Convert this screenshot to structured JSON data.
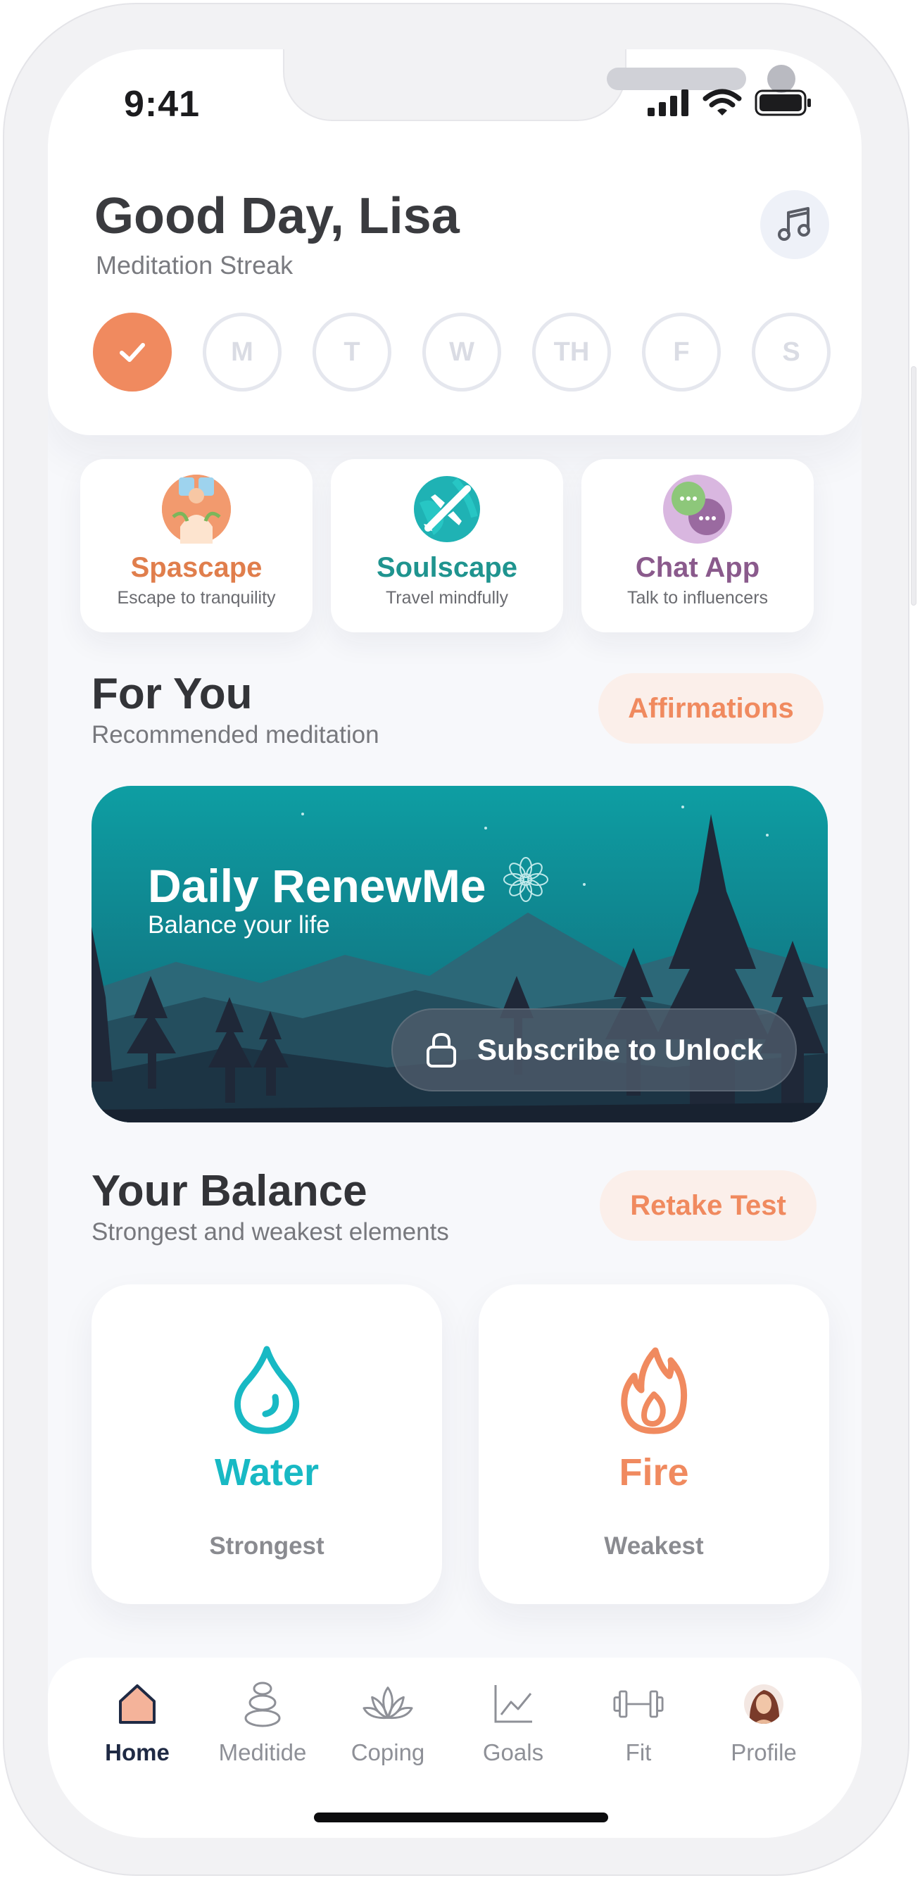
{
  "status_bar": {
    "time": "9:41"
  },
  "header": {
    "greeting": "Good Day, Lisa",
    "streak_label": "Meditation Streak",
    "days": [
      "M",
      "T",
      "W",
      "TH",
      "F",
      "S"
    ]
  },
  "apps": [
    {
      "title": "Spascape",
      "subtitle": "Escape to tranquility",
      "color": "#e07e4c"
    },
    {
      "title": "Soulscape",
      "subtitle": "Travel mindfully",
      "color": "#1f948f"
    },
    {
      "title": "Chat App",
      "subtitle": "Talk to influencers",
      "color": "#8a5a8c"
    }
  ],
  "for_you": {
    "title": "For You",
    "subtitle": "Recommended meditation",
    "button": "Affirmations"
  },
  "banner": {
    "title": "Daily RenewMe",
    "subtitle": "Balance your life",
    "button": "Subscribe to Unlock"
  },
  "balance": {
    "title": "Your Balance",
    "subtitle": "Strongest and weakest elements",
    "button": "Retake Test",
    "cards": [
      {
        "element": "Water",
        "rank": "Strongest",
        "color": "#18b9c4"
      },
      {
        "element": "Fire",
        "rank": "Weakest",
        "color": "#f08a5f"
      }
    ]
  },
  "tabbar": {
    "items": [
      {
        "label": "Home",
        "icon": "home-icon",
        "active": true
      },
      {
        "label": "Meditide",
        "icon": "stones-icon"
      },
      {
        "label": "Coping",
        "icon": "lotus-icon"
      },
      {
        "label": "Goals",
        "icon": "chart-line-icon"
      },
      {
        "label": "Fit",
        "icon": "dumbbell-icon"
      },
      {
        "label": "Profile",
        "icon": "avatar"
      }
    ]
  },
  "colors": {
    "accent": "#f08a5f",
    "teal": "#18b9c4",
    "background": "#f7f8fb"
  }
}
